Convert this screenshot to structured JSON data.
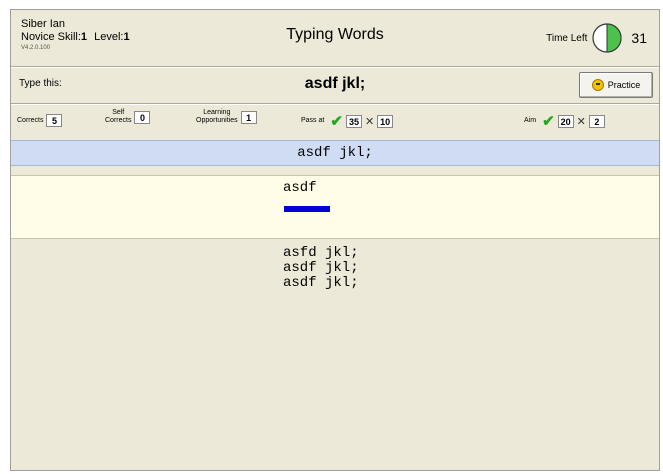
{
  "header": {
    "user_name": "Siber Ian",
    "skill_label": "Novice Skill:",
    "skill_value": "1",
    "level_label": "Level:",
    "level_value": "1",
    "version": "V4.2.0.100",
    "title": "Typing Words",
    "time_left_label": "Time Left",
    "time_left_value": "31",
    "timer_fraction_remaining": 0.5
  },
  "prompt": {
    "label": "Type this:",
    "target_text": "asdf jkl;",
    "practice_label": "Practice"
  },
  "stats": {
    "corrects_label": "Corrects",
    "corrects_value": "5",
    "self_corrects_label_1": "Self",
    "self_corrects_label_2": "Corrects",
    "self_corrects_value": "0",
    "learning_label_1": "Learning",
    "learning_label_2": "Opportunities",
    "learning_value": "1",
    "pass_label": "Pass at",
    "pass_wpm": "35",
    "pass_errors": "10",
    "aim_label": "Aim",
    "aim_wpm": "20",
    "aim_errors": "2"
  },
  "typing": {
    "current_target": "asdf jkl;",
    "typed": "asdf",
    "history": [
      "asfd jkl;",
      "asdf jkl;",
      "asdf jkl;"
    ]
  },
  "colors": {
    "target_line_bg": "#cfdcf3",
    "input_bg": "#fffde7",
    "cursor": "#0000d8",
    "check": "#1faa1f",
    "timer_fill": "#4cc24c"
  },
  "icons": {
    "practice": "smiley-icon",
    "pass": "check-icon",
    "errors": "x-icon"
  }
}
